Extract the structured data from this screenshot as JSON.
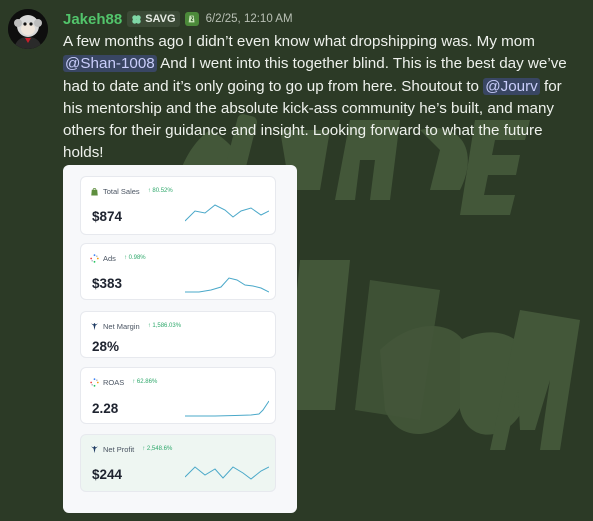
{
  "message": {
    "username": "Jakeh88",
    "tag": "SAVG",
    "timestamp": "6/2/25, 12:10 AM",
    "text_1": "A few months ago I didn’t even know what dropshipping was.  My mom ",
    "mention_1": "@Shan-1008",
    "text_2": " And I went into this together blind.  This is the best day we’ve had to date and it’s only going to go up from here.  Shoutout to ",
    "mention_2": "@Jourv",
    "text_3": " for his mentorship and the absolute kick-ass community he’s built, and many others for their guidance and insight.  Looking forward to what the future holds!"
  },
  "dashboard": {
    "metrics": [
      {
        "label": "Total Sales",
        "change": "↑ 80.52%",
        "value": "$874",
        "icon": "shopify-bag-icon"
      },
      {
        "label": "Ads",
        "change": "↑ 0.98%",
        "value": "$383",
        "icon": "dots-spinner-icon"
      },
      {
        "label": "Net Margin",
        "change": "↑ 1,586.03%",
        "value": "28%",
        "icon": "trident-icon"
      },
      {
        "label": "ROAS",
        "change": "↑ 62.86%",
        "value": "2.28",
        "icon": "dots-spinner-icon"
      },
      {
        "label": "Net Profit",
        "change": "↑ 2,548.6%",
        "value": "$244",
        "icon": "trident-icon"
      }
    ]
  },
  "colors": {
    "background": "#2c3a26",
    "username": "#52c46b",
    "mention_bg": "#5865f2",
    "spark_line": "#4aa8c9",
    "change_green": "#2ea86b"
  }
}
